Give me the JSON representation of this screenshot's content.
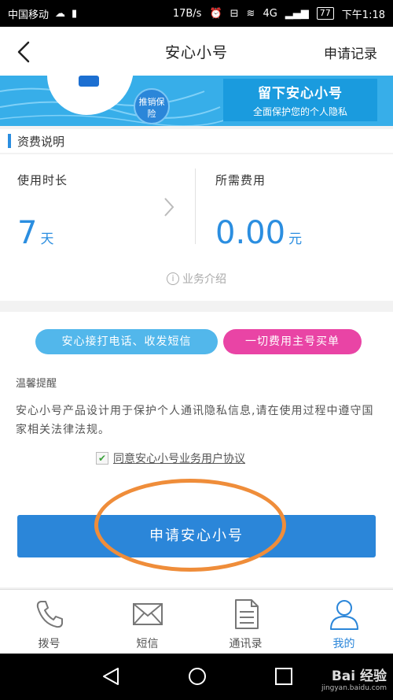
{
  "statusbar": {
    "carrier": "中国移动",
    "speed": "17B/s",
    "network": "4G",
    "battery": "77",
    "time": "下午1:18"
  },
  "navbar": {
    "title": "安心小号",
    "right_label": "申请记录"
  },
  "banner": {
    "badge": "推销保险",
    "headline": "留下安心小号",
    "subline": "全面保护您的个人隐私"
  },
  "fee": {
    "section_title": "资费说明",
    "duration_label": "使用时长",
    "duration_value": "7",
    "duration_unit": "天",
    "cost_label": "所需费用",
    "cost_value": "0.00",
    "cost_unit": "元",
    "intro_link": "业务介绍"
  },
  "features": {
    "pill_1": "安心接打电话、收发短信",
    "pill_2": "一切费用主号买单"
  },
  "tips": {
    "title": "温馨提醒",
    "body": "安心小号产品设计用于保护个人通讯隐私信息,请在使用过程中遵守国家相关法律法规。"
  },
  "agreement": {
    "checked": true,
    "label": "同意安心小号业务用户协议"
  },
  "apply_button": "申请安心小号",
  "tabs": [
    {
      "label": "拨号",
      "icon": "phone-icon"
    },
    {
      "label": "短信",
      "icon": "message-icon"
    },
    {
      "label": "通讯录",
      "icon": "contacts-icon"
    },
    {
      "label": "我的",
      "icon": "profile-icon",
      "active": true
    }
  ],
  "watermark": {
    "logo": "Bai 经验",
    "url": "jingyan.baidu.com"
  },
  "colors": {
    "accent": "#2b86d9",
    "pill_blue": "#52b7eb",
    "pill_pink": "#e944a5",
    "highlight_circle": "#ef8d3a"
  }
}
